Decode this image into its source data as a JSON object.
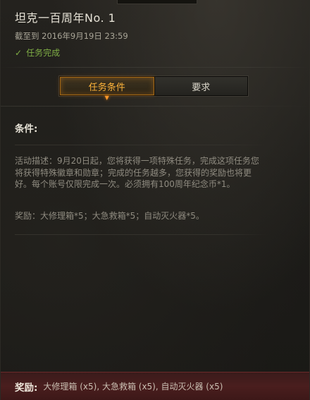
{
  "mission": {
    "title": "坦克一百周年No. 1",
    "deadline": "截至到 2016年9月19日 23:59",
    "status": "任务完成"
  },
  "tabs": [
    {
      "label": "任务条件",
      "active": true
    },
    {
      "label": "要求",
      "active": false
    }
  ],
  "conditions": {
    "heading": "条件:",
    "description": "活动描述：9月20日起，您将获得一项特殊任务，完成这项任务您将获得特殊徽章和勋章；完成的任务越多，您获得的奖励也将更好。每个账号仅限完成一次。必须拥有100周年纪念币*1。",
    "reward_line": "奖励：大修理箱*5；大急救箱*5；自动灭火器*5。"
  },
  "footer": {
    "label": "奖励:",
    "text": "大修理箱 (x5), 大急救箱 (x5), 自动灭火器 (x5)"
  },
  "colors": {
    "accent_orange": "#ffb43a",
    "status_green": "#7fae45",
    "footer_red": "#4a1e1e"
  }
}
